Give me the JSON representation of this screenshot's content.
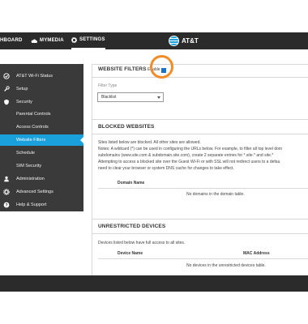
{
  "topnav": {
    "dashboard": "HBOARD",
    "mymedia": "MYMEDIA",
    "settings": "SETTINGS",
    "brand": "AT&T"
  },
  "sidebar": {
    "items": [
      {
        "label": "AT&T Wi-Fi Status",
        "icon": "check-circle-icon"
      },
      {
        "label": "Setup",
        "icon": "wrench-icon"
      },
      {
        "label": "Security",
        "icon": "shield-icon"
      },
      {
        "label": "Parental Controls",
        "icon": ""
      },
      {
        "label": "Access Controls",
        "icon": ""
      },
      {
        "label": "Website Filters",
        "icon": ""
      },
      {
        "label": "Schedule",
        "icon": ""
      },
      {
        "label": "SIM Security",
        "icon": ""
      },
      {
        "label": "Administration",
        "icon": "person-icon"
      },
      {
        "label": "Advanced Settings",
        "icon": "gear-icon"
      },
      {
        "label": "Help & Support",
        "icon": "question-icon"
      }
    ]
  },
  "website_filters": {
    "title": "WEBSITE FILTERS",
    "enable_label": "Enable",
    "filter_type_label": "Filter Type",
    "filter_type_value": "Blacklist"
  },
  "blocked_websites": {
    "title": "BLOCKED WEBSITES",
    "desc1": "Sites listed below are blocked. All other sites are allowed.",
    "desc2": "Notes: A wildcard (*) can be used in configuring the URLs below. For example, to filter all top level dom",
    "desc3": "subdomains (www.site.com & subdomain.site.com), create 2 separate entries for *.site.* and site.*",
    "desc4": "Attempting to access a blocked site over the Guest Wi-Fi or with SSL will not redirect users to a defau",
    "desc5": "need to clear your browser or system DNS cache for changes to take effect.",
    "col_domain": "Domain Name",
    "empty": "No domains in the domain table."
  },
  "unrestricted_devices": {
    "title": "UNRESTRICTED DEVICES",
    "desc": "Devices listed below have full access to all sites.",
    "col_device": "Device Name",
    "col_mac": "MAC Address",
    "empty": "No devices in the unrestricted devices table."
  },
  "colors": {
    "topbar": "#2b2b2b",
    "sidebar": "#3a3a3a",
    "accent": "#1aa0db",
    "highlight": "#f28c28"
  }
}
